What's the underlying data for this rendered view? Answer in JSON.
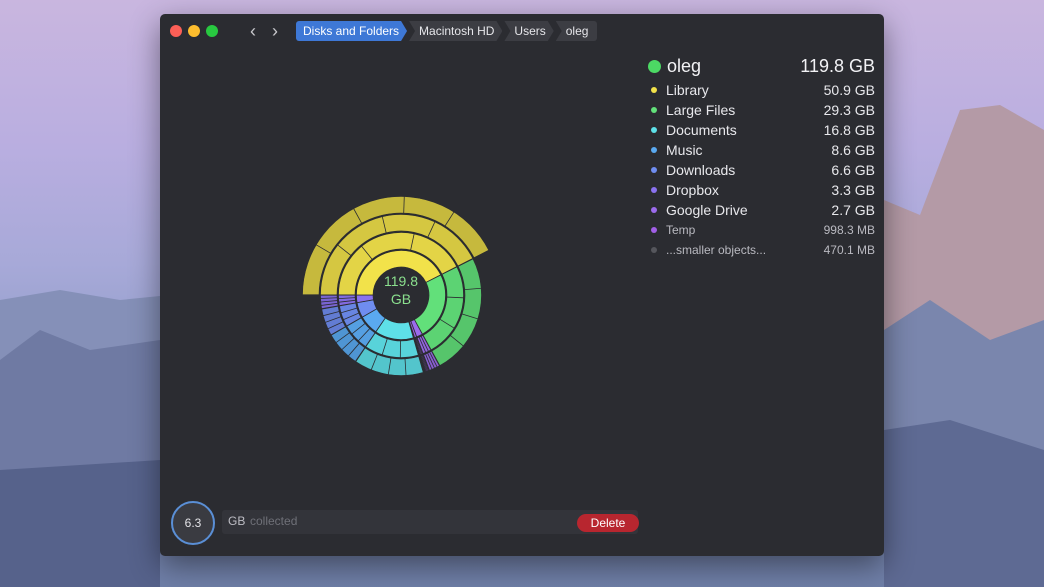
{
  "breadcrumbs": [
    "Disks and Folders",
    "Macintosh HD",
    "Users",
    "oleg"
  ],
  "total": {
    "name": "oleg",
    "size": "119.8 GB",
    "center_value": "119.8",
    "center_unit": "GB",
    "color": "#4cd964"
  },
  "legend": [
    {
      "label": "Library",
      "size": "50.9 GB",
      "color": "#f2e24a"
    },
    {
      "label": "Large Files",
      "size": "29.3 GB",
      "color": "#62e07a"
    },
    {
      "label": "Documents",
      "size": "16.8 GB",
      "color": "#5ee0e8"
    },
    {
      "label": "Music",
      "size": "8.6 GB",
      "color": "#5aa9f0"
    },
    {
      "label": "Downloads",
      "size": "6.6 GB",
      "color": "#6f8df0"
    },
    {
      "label": "Dropbox",
      "size": "3.3 GB",
      "color": "#8a72ef"
    },
    {
      "label": "Google Drive",
      "size": "2.7 GB",
      "color": "#9b6bec"
    },
    {
      "label": "Temp",
      "size": "998.3  MB",
      "color": "#a15fe6"
    },
    {
      "label": "...smaller objects...",
      "size": "470.1  MB",
      "color": "#55565c"
    }
  ],
  "collector": {
    "value": "6.3",
    "unit": "GB",
    "text": "collected",
    "delete_label": "Delete"
  },
  "nav": {
    "back_icon": "chevron-left-icon",
    "forward_icon": "chevron-right-icon"
  }
}
